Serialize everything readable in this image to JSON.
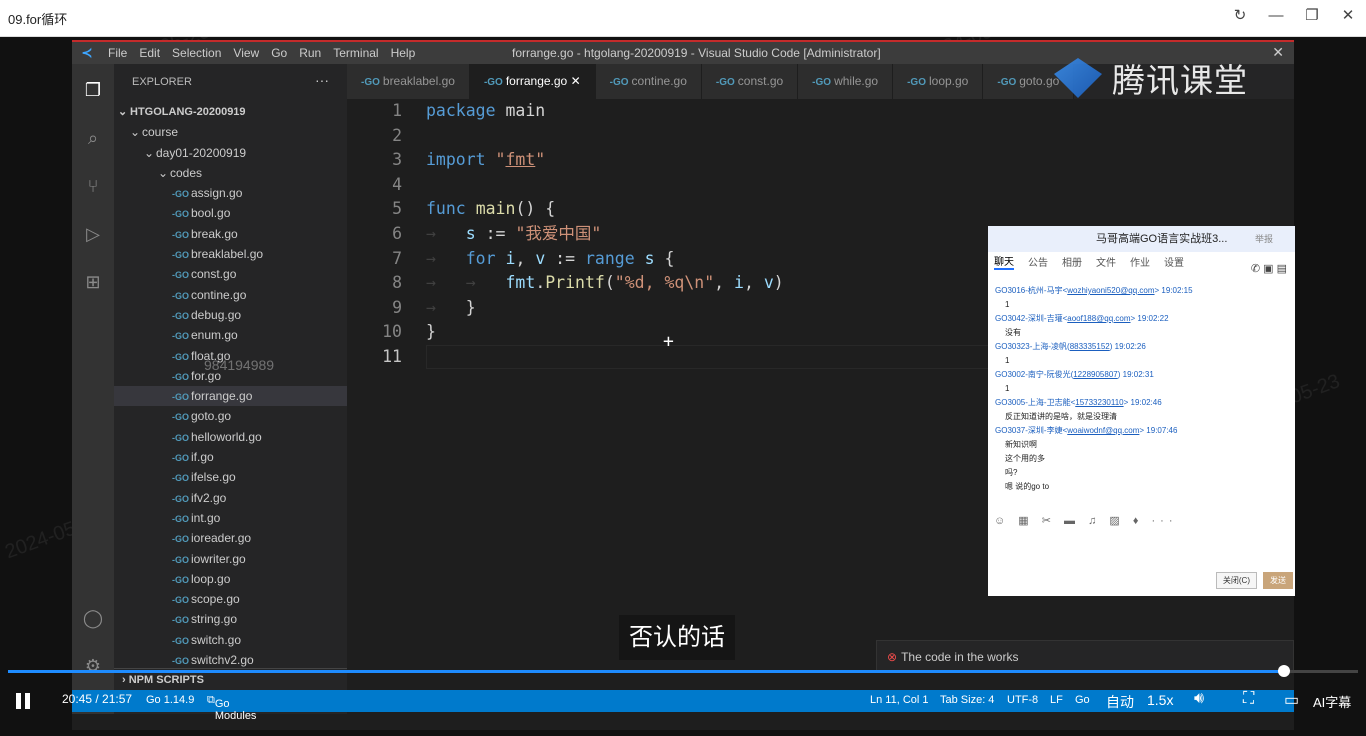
{
  "player": {
    "title": "09.for循环",
    "refresh_icon": "↻",
    "min_icon": "—",
    "restore_icon": "❐",
    "close_icon": "✕",
    "time": "20:45 / 21:57",
    "progress": 0.945,
    "quality": "自动",
    "speed": "1.5x",
    "ai_sub": "AI字幕",
    "subtitle": "否认的话"
  },
  "vscode": {
    "menu": [
      "File",
      "Edit",
      "Selection",
      "View",
      "Go",
      "Run",
      "Terminal",
      "Help"
    ],
    "window_title": "forrange.go - htgolang-20200919 - Visual Studio Code [Administrator]",
    "explorer_title": "EXPLORER",
    "tree": {
      "root": "HTGOLANG-20200919",
      "course": "course",
      "day": "day01-20200919",
      "codes": "codes",
      "files": [
        "assign.go",
        "bool.go",
        "break.go",
        "breaklabel.go",
        "const.go",
        "contine.go",
        "debug.go",
        "enum.go",
        "float.go",
        "for.go",
        "forrange.go",
        "goto.go",
        "helloworld.go",
        "if.go",
        "ifelse.go",
        "ifv2.go",
        "int.go",
        "ioreader.go",
        "iowriter.go",
        "loop.go",
        "scope.go",
        "string.go",
        "switch.go",
        "switchv2.go"
      ],
      "selected": "forrange.go"
    },
    "npm_scripts": "NPM SCRIPTS",
    "tabs": [
      "breaklabel.go",
      "forrange.go",
      "contine.go",
      "const.go",
      "while.go",
      "loop.go",
      "goto.go"
    ],
    "active_tab": "forrange.go",
    "code_lines": [
      "1",
      "2",
      "3",
      "4",
      "5",
      "6",
      "7",
      "8",
      "9",
      "10",
      "11"
    ],
    "status": {
      "go_version": "Go 1.14.9",
      "modules": "Go Modules",
      "position": "Ln 11, Col 1",
      "tab_size": "Tab Size: 4",
      "encoding": "UTF-8",
      "eol": "LF",
      "lang": "Go"
    },
    "notification": "The code in the works"
  },
  "brand": "腾讯课堂",
  "watermark_number": "984194989",
  "chat": {
    "title": "马哥高端GO语言实战班3...",
    "report": "举报",
    "tabs": [
      "聊天",
      "公告",
      "相册",
      "文件",
      "作业",
      "设置"
    ],
    "messages": [
      {
        "user": "GO3016-杭州-马宇<",
        "email": "wozhiyaoni520@qq.com",
        "time": "> 19:02:15",
        "body": "1"
      },
      {
        "user": "GO3042-深圳-吉瓘<",
        "email": "aoof188@qq.com",
        "time": "> 19:02:22",
        "body": "没有"
      },
      {
        "user": "GO30323-上海-凌帆(",
        "email": "883335152",
        "time": ") 19:02:26",
        "body": "1"
      },
      {
        "user": "GO3002-南宁-阮俊光(",
        "email": "1228905807",
        "time": ") 19:02:31",
        "body": "1"
      },
      {
        "user": "GO3005-上海-卫志能<",
        "email": "15733230110",
        "time": "> 19:02:46",
        "body": "反正知道讲的是啥，就是没理清"
      },
      {
        "user": "GO3037-深圳-李婕<",
        "email": "woaiwodnf@qq.com",
        "time": "> 19:07:46",
        "body": "新知识啊"
      }
    ],
    "extra_lines": [
      "这个用的多",
      "吗?",
      "嗯 说的go to"
    ],
    "close_btn": "关闭(C)",
    "send_btn": "发送"
  }
}
